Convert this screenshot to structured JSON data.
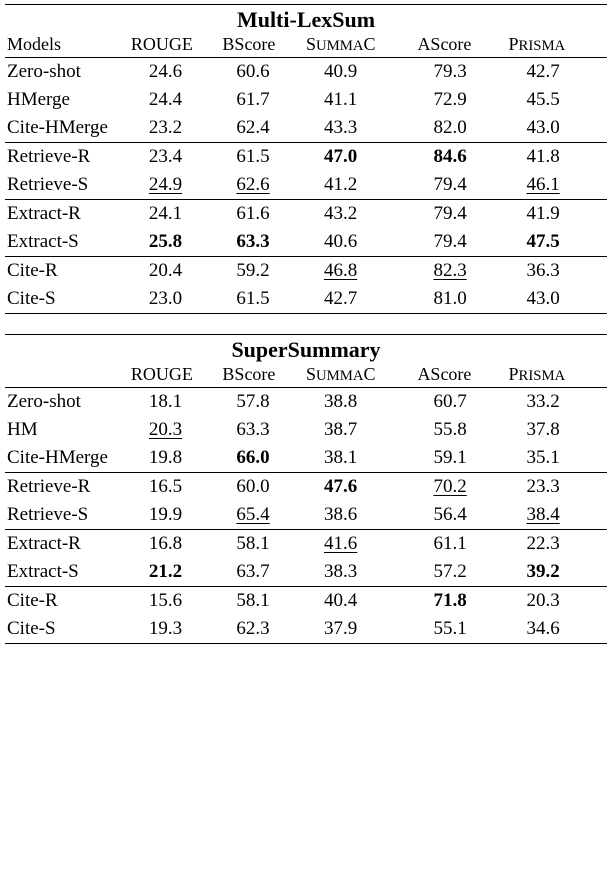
{
  "chart_data": [
    {
      "type": "table",
      "title": "Multi-LexSum",
      "columns": [
        "Models",
        "ROUGE",
        "BScore",
        "SUMMAC",
        "AScore",
        "PRISMA"
      ],
      "rows": [
        {
          "model": "Zero-shot",
          "rouge": {
            "v": "24.6"
          },
          "bscore": {
            "v": "60.6"
          },
          "summac": {
            "v": "40.9"
          },
          "ascore": {
            "v": "79.3"
          },
          "prisma": {
            "v": "42.7"
          }
        },
        {
          "model": "HMerge",
          "rouge": {
            "v": "24.4"
          },
          "bscore": {
            "v": "61.7"
          },
          "summac": {
            "v": "41.1"
          },
          "ascore": {
            "v": "72.9"
          },
          "prisma": {
            "v": "45.5"
          }
        },
        {
          "model": "Cite-HMerge",
          "rouge": {
            "v": "23.2"
          },
          "bscore": {
            "v": "62.4"
          },
          "summac": {
            "v": "43.3"
          },
          "ascore": {
            "v": "82.0"
          },
          "prisma": {
            "v": "43.0"
          }
        },
        {
          "model": "Retrieve-R",
          "rouge": {
            "v": "23.4"
          },
          "bscore": {
            "v": "61.5"
          },
          "summac": {
            "v": "47.0",
            "bold": true
          },
          "ascore": {
            "v": "84.6",
            "bold": true
          },
          "prisma": {
            "v": "41.8"
          },
          "sep": true
        },
        {
          "model": "Retrieve-S",
          "rouge": {
            "v": "24.9",
            "ul": true
          },
          "bscore": {
            "v": "62.6",
            "ul": true
          },
          "summac": {
            "v": "41.2"
          },
          "ascore": {
            "v": "79.4"
          },
          "prisma": {
            "v": "46.1",
            "ul": true
          }
        },
        {
          "model": "Extract-R",
          "rouge": {
            "v": "24.1"
          },
          "bscore": {
            "v": "61.6"
          },
          "summac": {
            "v": "43.2"
          },
          "ascore": {
            "v": "79.4"
          },
          "prisma": {
            "v": "41.9"
          },
          "sep": true
        },
        {
          "model": "Extract-S",
          "rouge": {
            "v": "25.8",
            "bold": true
          },
          "bscore": {
            "v": "63.3",
            "bold": true
          },
          "summac": {
            "v": "40.6"
          },
          "ascore": {
            "v": "79.4"
          },
          "prisma": {
            "v": "47.5",
            "bold": true
          }
        },
        {
          "model": "Cite-R",
          "rouge": {
            "v": "20.4"
          },
          "bscore": {
            "v": "59.2"
          },
          "summac": {
            "v": "46.8",
            "ul": true
          },
          "ascore": {
            "v": "82.3",
            "ul": true
          },
          "prisma": {
            "v": "36.3"
          },
          "sep": true
        },
        {
          "model": "Cite-S",
          "rouge": {
            "v": "23.0"
          },
          "bscore": {
            "v": "61.5"
          },
          "summac": {
            "v": "42.7"
          },
          "ascore": {
            "v": "81.0"
          },
          "prisma": {
            "v": "43.0"
          },
          "last": true
        }
      ]
    },
    {
      "type": "table",
      "title": "SuperSummary",
      "columns": [
        "",
        "ROUGE",
        "BScore",
        "SUMMAC",
        "AScore",
        "PRISMA"
      ],
      "rows": [
        {
          "model": "Zero-shot",
          "rouge": {
            "v": "18.1"
          },
          "bscore": {
            "v": "57.8"
          },
          "summac": {
            "v": "38.8"
          },
          "ascore": {
            "v": "60.7"
          },
          "prisma": {
            "v": "33.2"
          }
        },
        {
          "model": "HM",
          "rouge": {
            "v": "20.3",
            "ul": true
          },
          "bscore": {
            "v": "63.3"
          },
          "summac": {
            "v": "38.7"
          },
          "ascore": {
            "v": "55.8"
          },
          "prisma": {
            "v": "37.8"
          }
        },
        {
          "model": "Cite-HMerge",
          "rouge": {
            "v": "19.8"
          },
          "bscore": {
            "v": "66.0",
            "bold": true
          },
          "summac": {
            "v": "38.1"
          },
          "ascore": {
            "v": "59.1"
          },
          "prisma": {
            "v": "35.1"
          }
        },
        {
          "model": "Retrieve-R",
          "rouge": {
            "v": "16.5"
          },
          "bscore": {
            "v": "60.0"
          },
          "summac": {
            "v": "47.6",
            "bold": true
          },
          "ascore": {
            "v": "70.2",
            "ul": true
          },
          "prisma": {
            "v": "23.3"
          },
          "sep": true
        },
        {
          "model": "Retrieve-S",
          "rouge": {
            "v": "19.9"
          },
          "bscore": {
            "v": "65.4",
            "ul": true
          },
          "summac": {
            "v": "38.6"
          },
          "ascore": {
            "v": "56.4"
          },
          "prisma": {
            "v": "38.4",
            "ul": true
          }
        },
        {
          "model": "Extract-R",
          "rouge": {
            "v": "16.8"
          },
          "bscore": {
            "v": "58.1"
          },
          "summac": {
            "v": "41.6",
            "ul": true
          },
          "ascore": {
            "v": "61.1"
          },
          "prisma": {
            "v": "22.3"
          },
          "sep": true
        },
        {
          "model": "Extract-S",
          "rouge": {
            "v": "21.2",
            "bold": true
          },
          "bscore": {
            "v": "63.7"
          },
          "summac": {
            "v": "38.3"
          },
          "ascore": {
            "v": "57.2"
          },
          "prisma": {
            "v": "39.2",
            "bold": true
          }
        },
        {
          "model": "Cite-R",
          "rouge": {
            "v": "15.6"
          },
          "bscore": {
            "v": "58.1"
          },
          "summac": {
            "v": "40.4"
          },
          "ascore": {
            "v": "71.8",
            "bold": true
          },
          "prisma": {
            "v": "20.3"
          },
          "sep": true
        },
        {
          "model": "Cite-S",
          "rouge": {
            "v": "19.3"
          },
          "bscore": {
            "v": "62.3"
          },
          "summac": {
            "v": "37.9"
          },
          "ascore": {
            "v": "55.1"
          },
          "prisma": {
            "v": "34.6"
          },
          "last": true
        }
      ]
    }
  ]
}
